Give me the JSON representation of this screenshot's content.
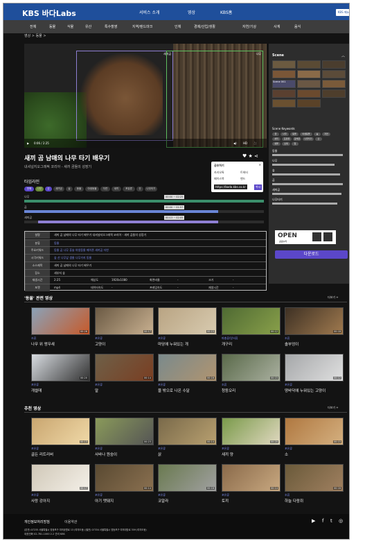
{
  "header": {
    "logo": "KBS 바다Labs",
    "nav": [
      "서비스 소개",
      "영상",
      "KBS홈"
    ],
    "lang": "KBS 메뉴"
  },
  "categories": [
    "전체",
    "동물",
    "식물",
    "유산",
    "특수촬영",
    "지역/랜드마크",
    "인체",
    "경제/산업/생활",
    "자연/기상",
    "사계",
    "음식"
  ],
  "breadcrumb": "영상 > 동물 >",
  "video": {
    "box1_label": "새끼곰",
    "box2_label": "나무",
    "time": "0:06 / 2:25",
    "hd": "HD"
  },
  "title": "새끼 곰 남매의 나무 타기 배우기",
  "subtitle": "내셔널지오그래픽 코리아 - 새끼 곰들의 성장기",
  "share": {
    "title": "공유하기",
    "kakao": "카카오톡",
    "twitter": "트위터",
    "facebook": "페이스북",
    "band": "밴드",
    "url": "https://bada.kbs.co.kr",
    "copy": "복사"
  },
  "timeline": {
    "label": "타임라인",
    "chips": [
      "전체",
      "나무",
      "곰",
      "새끼곰",
      "숲",
      "동물",
      "야생동물",
      "자연",
      "새끼",
      "포유류",
      "산",
      "나무타기"
    ],
    "tracks": [
      "나무",
      "곰",
      "새끼곰"
    ],
    "tags": [
      "00:00 ~ 02:25",
      "00:00 ~ 01:57",
      "00:13 ~ 02:05"
    ]
  },
  "meta": {
    "rows": [
      {
        "k": "설명",
        "v": "새끼 곰 남매의 나무 타기 배우기 내셔널지오그래픽 코리아 - 새끼 곰들의 성장기"
      },
      {
        "k": "분류",
        "v": "동물"
      },
      {
        "k": "주요키워드",
        "v": "동물 곰 나무 휴슬 야생동물 메이폰 새끼곰 자연"
      },
      {
        "k": "시각키워드",
        "v": "숲 산 나무잎 생물 나무가지 동물"
      },
      {
        "k": "소스제목",
        "v": "새끼 곰 남매의 나무 타기 배우기"
      },
      {
        "k": "장소",
        "v": "세부지 숲"
      }
    ],
    "grid": [
      [
        "재생시간",
        "2:25",
        "해상도",
        "1920x1080",
        "화면비율",
        "-",
        "크기",
        "-"
      ],
      [
        "포맷",
        "mp4",
        "데이터속도",
        "-",
        "프레임속도",
        "-",
        "재생시간",
        "-"
      ]
    ]
  },
  "side": {
    "scene_label": "Scene",
    "scene_thumb": "Scene 001",
    "kw_label": "Scene Keywords",
    "keywords": [
      "곰",
      "나무",
      "동물",
      "야생동물",
      "숲",
      "자연",
      "새끼",
      "포유류",
      "갈색곰",
      "나무타기",
      "산",
      "생물",
      "초목",
      "잎"
    ],
    "groups": [
      "동물",
      "나무",
      "숲",
      "곰",
      "새끼곰",
      "나무타기"
    ]
  },
  "license": {
    "open": "OPEN",
    "sub": "공공누리"
  },
  "download": "다운로드",
  "related": {
    "title": "'동물' 관련 영상",
    "more": "더보기 +",
    "items": [
      {
        "cat": "조류",
        "name": "나무 위 앵무새",
        "dur": "00:26",
        "c1": "#8aa2b8",
        "c2": "#c75a2a"
      },
      {
        "cat": "포유류",
        "name": "고양이",
        "dur": "00:17",
        "c1": "#6b5a44",
        "c2": "#c8b090"
      },
      {
        "cat": "포유류",
        "name": "마당에 누워있는 개",
        "dur": "00:15",
        "c1": "#b9a483",
        "c2": "#d8cbb0"
      },
      {
        "cat": "파충류/양서류",
        "name": "개구리",
        "dur": "00:12",
        "c1": "#4f6a33",
        "c2": "#89a04a"
      },
      {
        "cat": "조류",
        "name": "솔부엉이",
        "dur": "00:18",
        "c1": "#3e3124",
        "c2": "#a07a4f"
      },
      {
        "cat": "포유류",
        "name": "개썰매",
        "dur": "00:20",
        "c1": "#d7dbe0",
        "c2": "#333"
      },
      {
        "cat": "포유류",
        "name": "말",
        "dur": "00:14",
        "c1": "#6e6048",
        "c2": "#7a3e22"
      },
      {
        "cat": "포유류",
        "name": "물 밖으로 나온 수달",
        "dur": "00:16",
        "c1": "#7a8a8c",
        "c2": "#b09470"
      },
      {
        "cat": "조류",
        "name": "청둥오리",
        "dur": "00:15",
        "c1": "#5a6a4a",
        "c2": "#aab0a0"
      },
      {
        "cat": "포유류",
        "name": "땅바닥에 누워있는 고양이",
        "dur": "00:12",
        "c1": "#a5a7a9",
        "c2": "#e0e0e0"
      }
    ]
  },
  "recommend": {
    "title": "추천 영상",
    "more": "더보기 +",
    "items": [
      {
        "cat": "포유류",
        "name": "골든 리트리버",
        "dur": "00:13",
        "c1": "#c9a670",
        "c2": "#f0d9a8"
      },
      {
        "cat": "포유류",
        "name": "사바나 원숭이",
        "dur": "00:23",
        "c1": "#8a9a5a",
        "c2": "#555"
      },
      {
        "cat": "포유류",
        "name": "삵",
        "dur": "00:14",
        "c1": "#7a6a4a",
        "c2": "#b8a070"
      },
      {
        "cat": "포유류",
        "name": "새끼 양",
        "dur": "00:20",
        "c1": "#7a9a4a",
        "c2": "#e0d8c0"
      },
      {
        "cat": "포유류",
        "name": "소",
        "dur": "00:15",
        "c1": "#b07840",
        "c2": "#d4b080"
      },
      {
        "cat": "포유류",
        "name": "사랑 강아지",
        "dur": "00:17",
        "c1": "#d0c8b8",
        "c2": "#f4f0e8"
      },
      {
        "cat": "포유류",
        "name": "아기 멧돼지",
        "dur": "00:14",
        "c1": "#5a4a32",
        "c2": "#8a7050"
      },
      {
        "cat": "포유류",
        "name": "코알라",
        "dur": "00:18",
        "c1": "#6a7a50",
        "c2": "#a0a0a0"
      },
      {
        "cat": "포유류",
        "name": "토끼",
        "dur": "00:14",
        "c1": "#8a6a4a",
        "c2": "#c8a880"
      },
      {
        "cat": "조류",
        "name": "하늘 다람쥐",
        "dur": "00:16",
        "c1": "#6a5a3a",
        "c2": "#a08060"
      }
    ]
  },
  "footer": {
    "links": [
      "개인정보처리방침",
      "이용약관"
    ],
    "address": "(본관) 07235 서울특별시 영등포구 여의공원로 13 (여의도동) (별관) 07334 서울특별시 영등포구 여의대방로 359 (여의도동)",
    "phone": "대표전화 02-781-1000   2.2 관리 KBS",
    "social": [
      "▶",
      "f",
      "t",
      "◎"
    ]
  }
}
